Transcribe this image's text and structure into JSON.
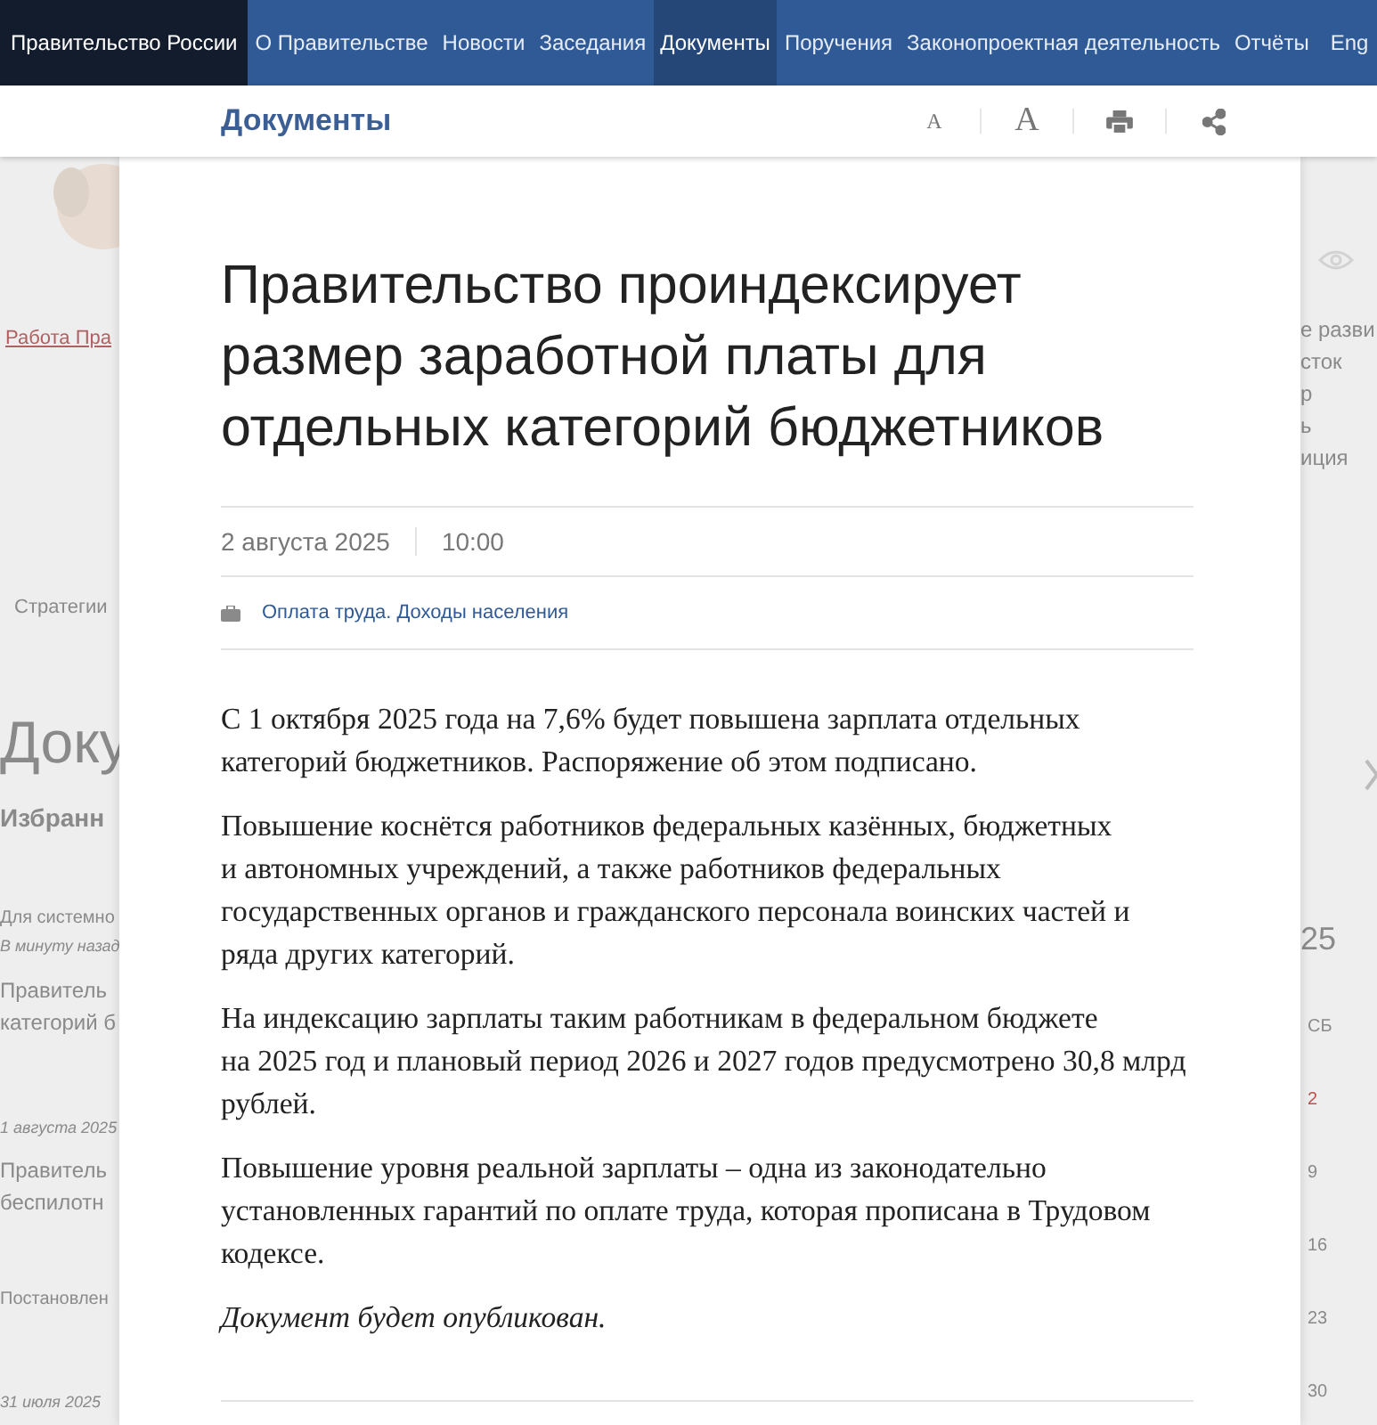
{
  "top_nav": {
    "brand": "Правительство России",
    "items": [
      {
        "label": "О Правительстве",
        "selected": false
      },
      {
        "label": "Новости",
        "selected": false
      },
      {
        "label": "Заседания",
        "selected": false
      },
      {
        "label": "Документы",
        "selected": true
      },
      {
        "label": "Поручения",
        "selected": false
      },
      {
        "label": "Законопроектная деятельность",
        "selected": false
      },
      {
        "label": "Отчёты",
        "selected": false
      }
    ],
    "language": "Eng"
  },
  "section_bar": {
    "title": "Документы",
    "tools": [
      {
        "kind": "font-small",
        "label": "A"
      },
      {
        "kind": "font-large",
        "label": "A"
      },
      {
        "kind": "print"
      },
      {
        "kind": "share"
      }
    ]
  },
  "background_page": {
    "left": [
      {
        "kind": "link",
        "text": "Работа Пра"
      },
      {
        "kind": "tab",
        "text": "Стратегии"
      },
      {
        "kind": "heading",
        "text": "Доку"
      },
      {
        "kind": "subheading",
        "text": "Избранн"
      },
      {
        "kind": "meta",
        "text": "Для системно"
      },
      {
        "kind": "time",
        "text": "В минуту назад"
      },
      {
        "kind": "title",
        "text": "Правитель"
      },
      {
        "kind": "title-cont",
        "text": "категорий б"
      },
      {
        "kind": "date",
        "text": "1 августа 2025"
      },
      {
        "kind": "title",
        "text": "Правитель"
      },
      {
        "kind": "title-cont",
        "text": "беспилотн"
      },
      {
        "kind": "meta",
        "text": "Постановлен"
      },
      {
        "kind": "date",
        "text": "31 июля 2025"
      }
    ],
    "right": [
      {
        "kind": "eye"
      },
      {
        "kind": "list",
        "text": "е разви"
      },
      {
        "kind": "list",
        "text": "сток"
      },
      {
        "kind": "list",
        "text": "р"
      },
      {
        "kind": "list",
        "text": "ь"
      },
      {
        "kind": "list",
        "text": "иция"
      },
      {
        "kind": "chevron"
      },
      {
        "kind": "year",
        "text": "25"
      },
      {
        "kind": "weekday",
        "text": "СБ"
      },
      {
        "kind": "holiday",
        "text": "2"
      },
      {
        "kind": "day",
        "text": "9"
      },
      {
        "kind": "day",
        "text": "16"
      },
      {
        "kind": "day",
        "text": "23"
      },
      {
        "kind": "day",
        "text": "30"
      }
    ]
  },
  "document": {
    "title": "Правительство проиндексирует размер заработной платы для отдельных категорий бюджетников",
    "date": "2 августа 2025",
    "time": "10:00",
    "tag": "Оплата труда. Доходы населения",
    "body": [
      {
        "kind": "paragraph",
        "text": "С 1 октября 2025 года на 7,6% будет повышена зарплата отдельных категорий бюджетников. Распоряжение об этом подписано."
      },
      {
        "kind": "paragraph",
        "text": "Повышение коснётся работников федеральных казённых, бюджетных и автономных учреждений, а также работников федеральных государственных органов и гражданского персонала воинских частей и ряда других категорий."
      },
      {
        "kind": "paragraph",
        "text": "На индексацию зарплаты таким работникам в федеральном бюджете на 2025 год и плановый период 2026 и 2027 годов предусмотрено 30,8 млрд рублей."
      },
      {
        "kind": "paragraph",
        "text": "Повышение уровня реальной зарплаты – одна из законодательно установленных гарантий по оплате труда, которая прописана в Трудовом кодексе."
      },
      {
        "kind": "note",
        "text": "Документ будет опубликован."
      }
    ]
  }
}
